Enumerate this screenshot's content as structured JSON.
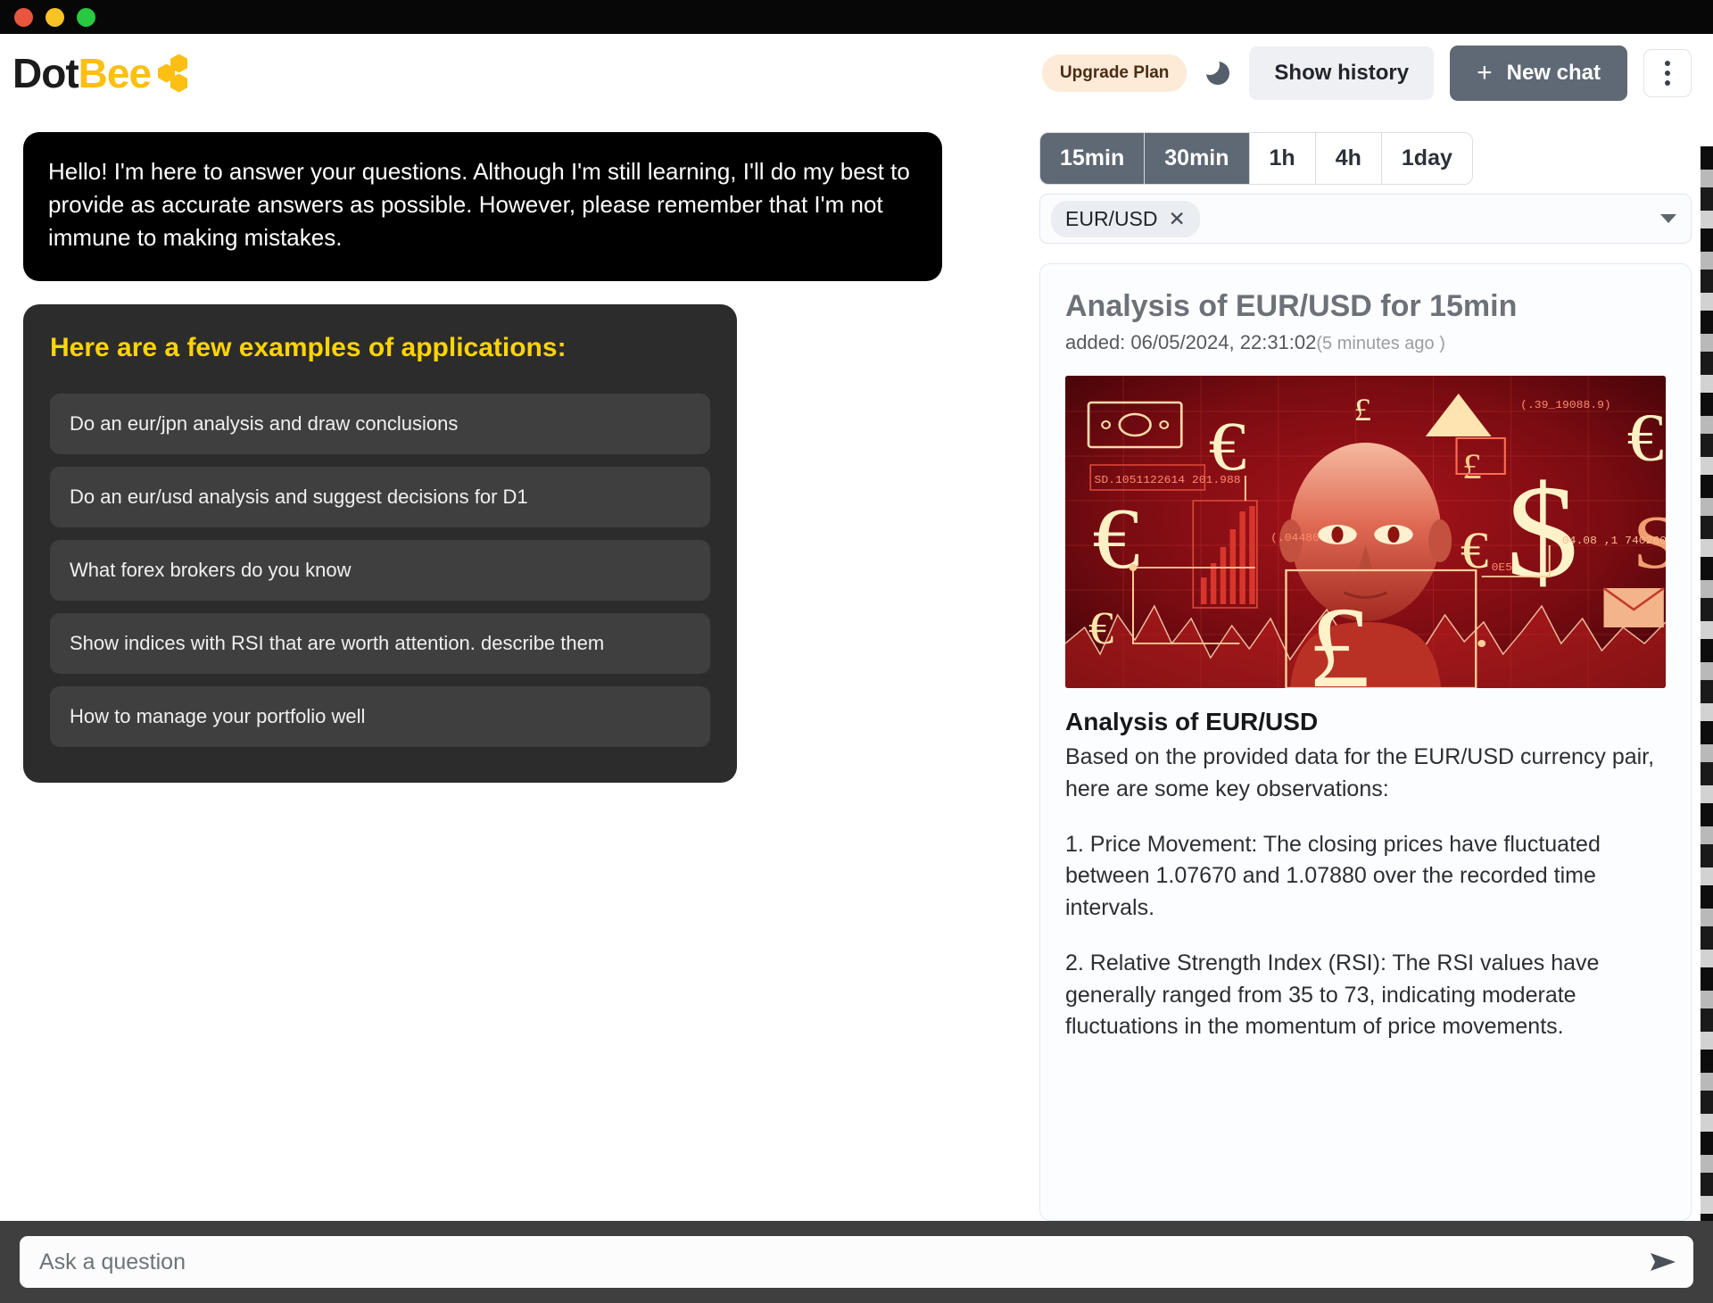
{
  "window": {
    "traffic_lights": [
      "close",
      "minimize",
      "maximize"
    ]
  },
  "header": {
    "logo_part1": "Dot",
    "logo_part2": "Bee",
    "upgrade_label": "Upgrade Plan",
    "theme_toggle_icon": "moon-icon",
    "show_history_label": "Show history",
    "new_chat_label": "New chat",
    "new_chat_icon": "plus-icon",
    "overflow_icon": "kebab-menu-icon"
  },
  "chat": {
    "greeting": "Hello! I'm here to answer your questions. Although I'm still learning, I'll do my best to provide as accurate answers as possible. However, please remember that I'm not immune to making mistakes.",
    "examples_title": "Here are a few examples of applications:",
    "examples": [
      "Do an eur/jpn analysis and draw conclusions",
      "Do an eur/usd analysis and suggest decisions for D1",
      "What forex brokers do you know",
      "Show indices with RSI that are worth attention. describe them",
      "How to manage your portfolio well"
    ]
  },
  "panel": {
    "timeframes": [
      {
        "label": "15min",
        "active": true
      },
      {
        "label": "30min",
        "active": true
      },
      {
        "label": "1h",
        "active": false
      },
      {
        "label": "4h",
        "active": false
      },
      {
        "label": "1day",
        "active": false
      }
    ],
    "selected_pair": "EUR/USD",
    "chip_remove_icon": "close-icon",
    "dropdown_icon": "chevron-down-icon"
  },
  "analysis": {
    "title": "Analysis of EUR/USD for 15min",
    "added_prefix": "added: ",
    "added_timestamp": "06/05/2024, 22:31:02",
    "added_relative": "(5 minutes ago )",
    "image_alt": "forex-ai-illustration",
    "body_heading": "Analysis of EUR/USD",
    "paragraphs": [
      "Based on the provided data for the EUR/USD currency pair, here are some key observations:",
      "1. Price Movement: The closing prices have fluctuated between 1.07670 and 1.07880 over the recorded time intervals.",
      "2. Relative Strength Index (RSI): The RSI values have generally ranged from 35 to 73, indicating moderate fluctuations in the momentum of price movements."
    ]
  },
  "composer": {
    "placeholder": "Ask a question",
    "send_icon": "send-arrow-icon"
  },
  "colors": {
    "brand_yellow": "#fcbf12",
    "examples_title": "#ffd400",
    "accent_slate": "#5f6875",
    "upgrade_bg": "#fdebd8",
    "panel_dark": "#2c2c2c",
    "bubble_black": "#000000"
  }
}
